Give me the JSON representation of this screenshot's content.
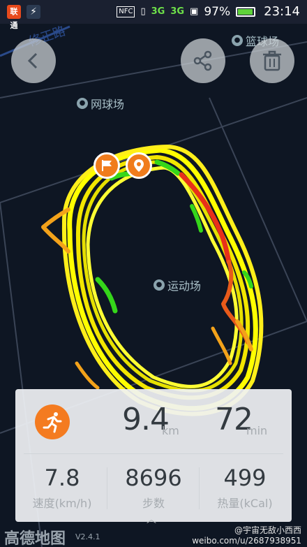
{
  "status_bar": {
    "carrier_badge": "联通",
    "network_primary": "3G",
    "network_secondary": "3G",
    "nfc_label": "NFC",
    "battery_percent": "97%",
    "battery_level": 0.97,
    "time": "23:14"
  },
  "map": {
    "poi_tennis": "网球场",
    "poi_basketball": "篮球场",
    "poi_sports_field": "运动场",
    "road_label": "修正路"
  },
  "route_colors": {
    "fast": "#ffff00",
    "medium": "#f3a21a",
    "slow": "#e8301a",
    "fastest": "#35d61a"
  },
  "toolbar": {
    "back_icon": "chevron-left-icon",
    "share_icon": "share-icon",
    "delete_icon": "trash-icon"
  },
  "markers": {
    "start_icon": "flag-icon",
    "end_icon": "location-pin-icon"
  },
  "stats": {
    "distance_value": "9.4",
    "distance_unit": "km",
    "duration_value": "72",
    "duration_unit": "min",
    "speed_value": "7.8",
    "speed_label": "速度(km/h)",
    "steps_value": "8696",
    "steps_label": "步数",
    "calories_value": "499",
    "calories_label": "热量(kCal)"
  },
  "footer": {
    "map_provider": "高德地图",
    "version": "V2.4.1",
    "watermark_user": "@宇宙无敌小西西",
    "watermark_url": "weibo.com/u/2687938951"
  }
}
